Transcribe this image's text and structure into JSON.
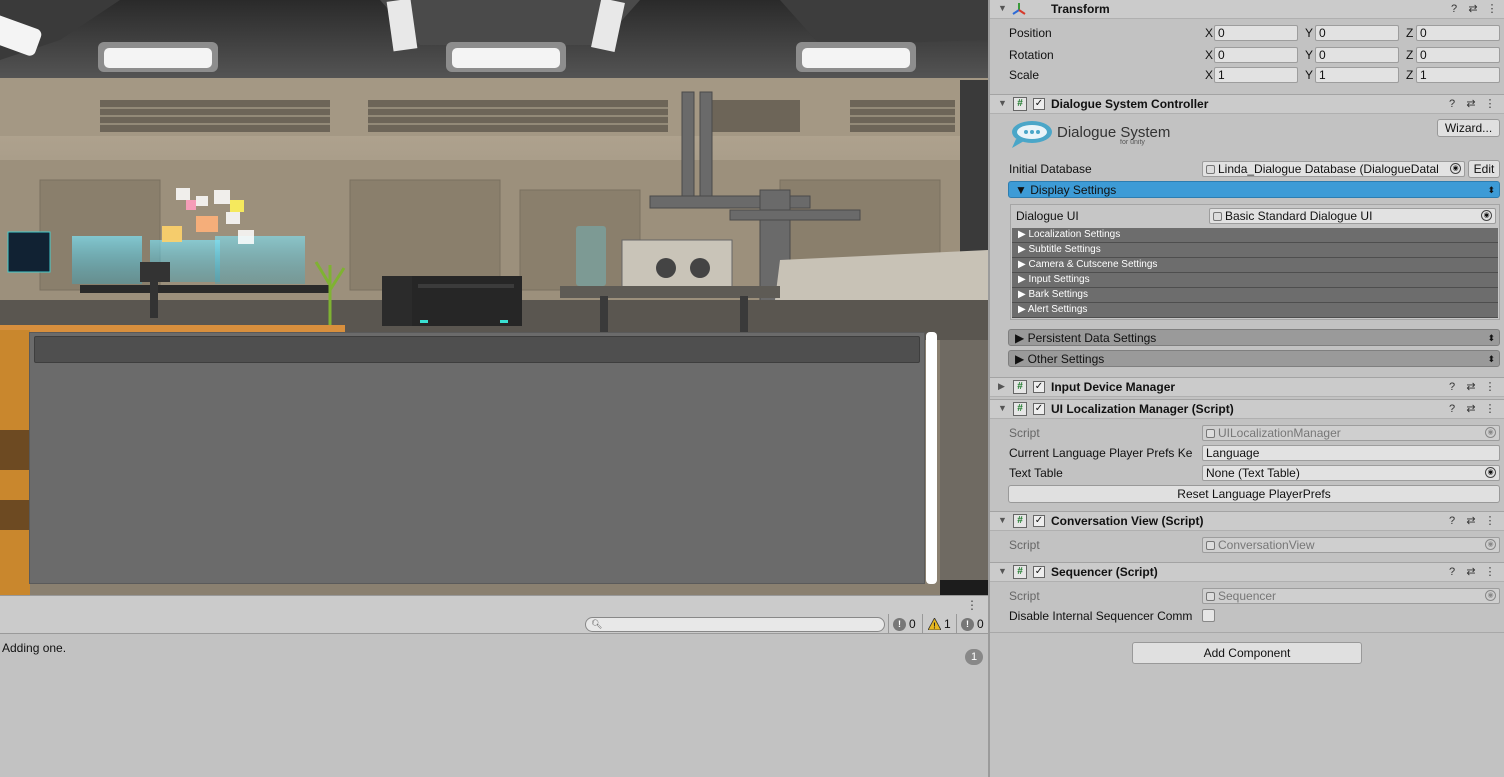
{
  "console": {
    "search_placeholder": "",
    "error_count": "0",
    "warning_count": "1",
    "message_count": "0",
    "log_message": "Adding one.",
    "log_collapse_count": "1"
  },
  "inspector": {
    "transform": {
      "title": "Transform",
      "position_label": "Position",
      "rotation_label": "Rotation",
      "scale_label": "Scale",
      "x_label": "X",
      "y_label": "Y",
      "z_label": "Z",
      "position": {
        "x": "0",
        "y": "0",
        "z": "0"
      },
      "rotation": {
        "x": "0",
        "y": "0",
        "z": "0"
      },
      "scale": {
        "x": "1",
        "y": "1",
        "z": "1"
      }
    },
    "dialogue_system_controller": {
      "title": "Dialogue System Controller",
      "logo_text": "Dialogue System",
      "logo_subtext": "for unity",
      "wizard_button": "Wizard...",
      "initial_database_label": "Initial Database",
      "initial_database_value": "Linda_Dialogue Database (DialogueDatal",
      "edit_button": "Edit",
      "display_settings_label": "Display Settings",
      "dialogue_ui_label": "Dialogue UI",
      "dialogue_ui_value": "Basic Standard Dialogue UI",
      "subsections": [
        "Localization Settings",
        "Subtitle Settings",
        "Camera & Cutscene Settings",
        "Input Settings",
        "Bark Settings",
        "Alert Settings"
      ],
      "persistent_data_label": "Persistent Data Settings",
      "other_settings_label": "Other Settings"
    },
    "input_device_manager": {
      "title": "Input Device Manager"
    },
    "ui_localization_manager": {
      "title": "UI Localization Manager (Script)",
      "script_label": "Script",
      "script_value": "UILocalizationManager",
      "current_language_label": "Current Language Player Prefs Ke",
      "current_language_value": "Language",
      "text_table_label": "Text Table",
      "text_table_value": "None (Text Table)",
      "reset_button": "Reset Language PlayerPrefs"
    },
    "conversation_view": {
      "title": "Conversation View (Script)",
      "script_label": "Script",
      "script_value": "ConversationView"
    },
    "sequencer": {
      "title": "Sequencer (Script)",
      "script_label": "Script",
      "script_value": "Sequencer",
      "disable_internal_label": "Disable Internal Sequencer Comm"
    },
    "add_component_button": "Add Component"
  },
  "colors": {
    "display_settings_bar": "#3d9bd6",
    "inspector_bg": "#c2c2c2",
    "dialogue_panel": "#6b6b6b"
  }
}
